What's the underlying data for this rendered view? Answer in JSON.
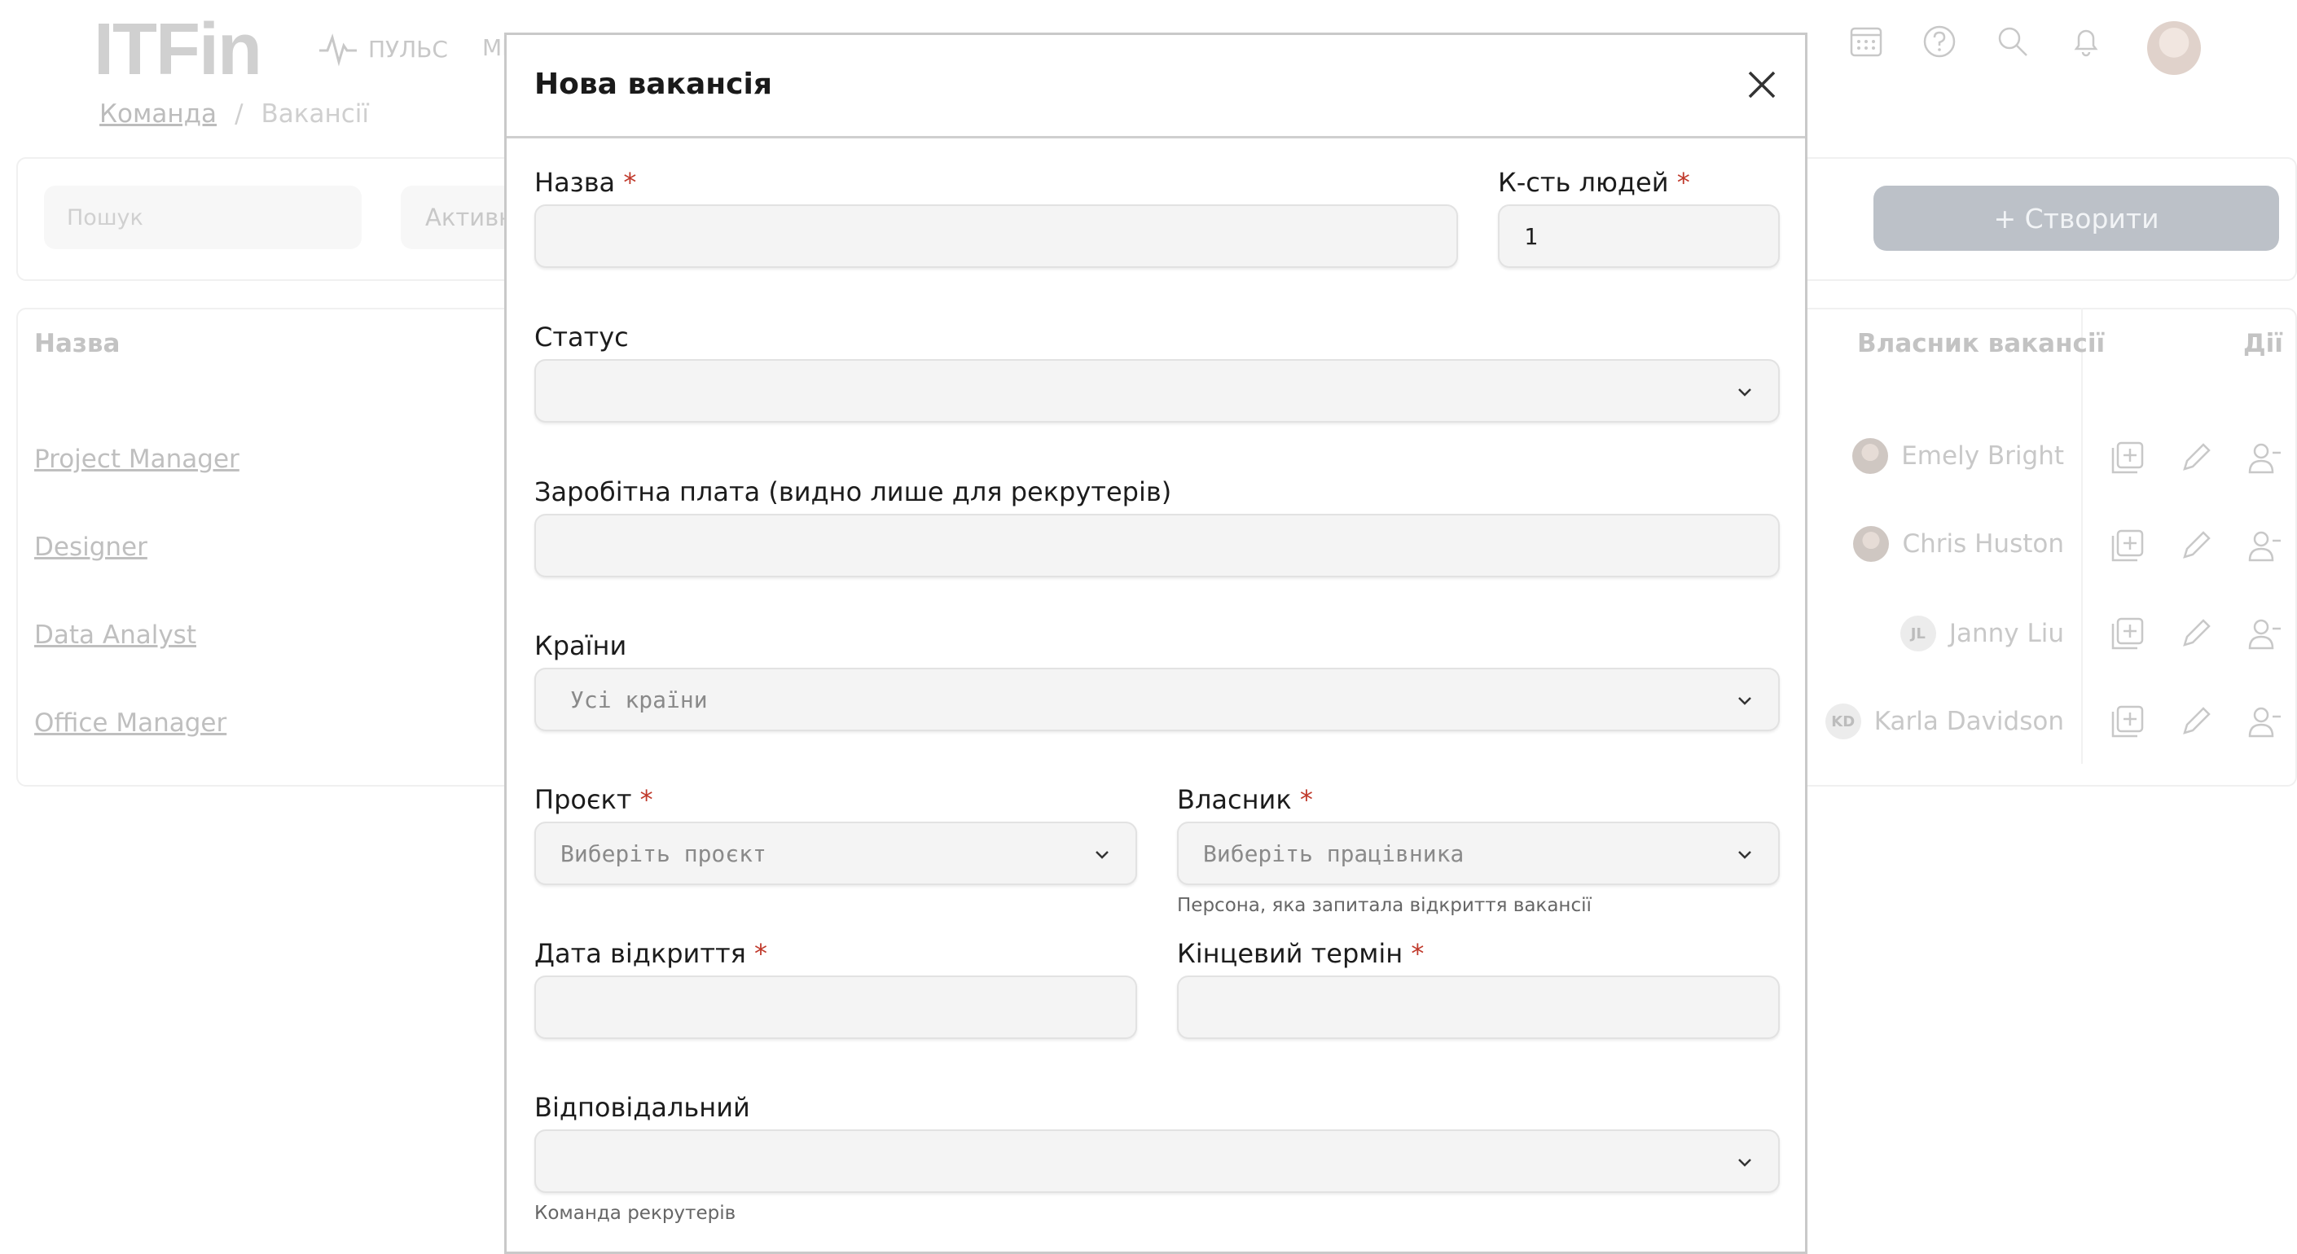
{
  "app": {
    "logo": "ITFin",
    "nav": {
      "pulse_label": "ПУЛЬС",
      "more_label": "МІ"
    },
    "breadcrumb": {
      "parent": "Команда",
      "separator": "/",
      "current": "Вакансії"
    },
    "toolbar": {
      "search_placeholder": "Пошук",
      "status_filter": "Активні",
      "filter_fragment": "а",
      "create_label": "+ Створити"
    },
    "table": {
      "headers": {
        "name": "Назва",
        "owner": "Власник вакансії",
        "actions": "Дії"
      },
      "rows": [
        {
          "name": "Project Manager",
          "owner": "Emely Bright",
          "initials": ""
        },
        {
          "name": "Designer",
          "owner": "Chris Huston",
          "initials": ""
        },
        {
          "name": "Data Analyst",
          "owner": "Janny Liu",
          "initials": "JL"
        },
        {
          "name": "Office Manager",
          "owner": "Karla Davidson",
          "initials": "KD"
        }
      ]
    }
  },
  "modal": {
    "title": "Нова вакансія",
    "fields": {
      "name": {
        "label": "Назва",
        "value": ""
      },
      "people_count": {
        "label": "К-сть людей",
        "value": "1"
      },
      "status": {
        "label": "Статус",
        "value": ""
      },
      "salary": {
        "label": "Заробітна плата (видно лише для рекрутерів)",
        "value": ""
      },
      "countries": {
        "label": "Країни",
        "placeholder": "Усі країни"
      },
      "project": {
        "label": "Проєкт",
        "placeholder": "Виберіть проєкт"
      },
      "owner": {
        "label": "Власник",
        "placeholder": "Виберіть працівника",
        "hint": "Персона, яка запитала відкриття вакансії"
      },
      "open_date": {
        "label": "Дата відкриття",
        "value": ""
      },
      "deadline": {
        "label": "Кінцевий термін",
        "value": ""
      },
      "responsible": {
        "label": "Відповідальний",
        "value": "",
        "hint": "Команда рекрутерів"
      }
    },
    "required_mark": "*"
  }
}
